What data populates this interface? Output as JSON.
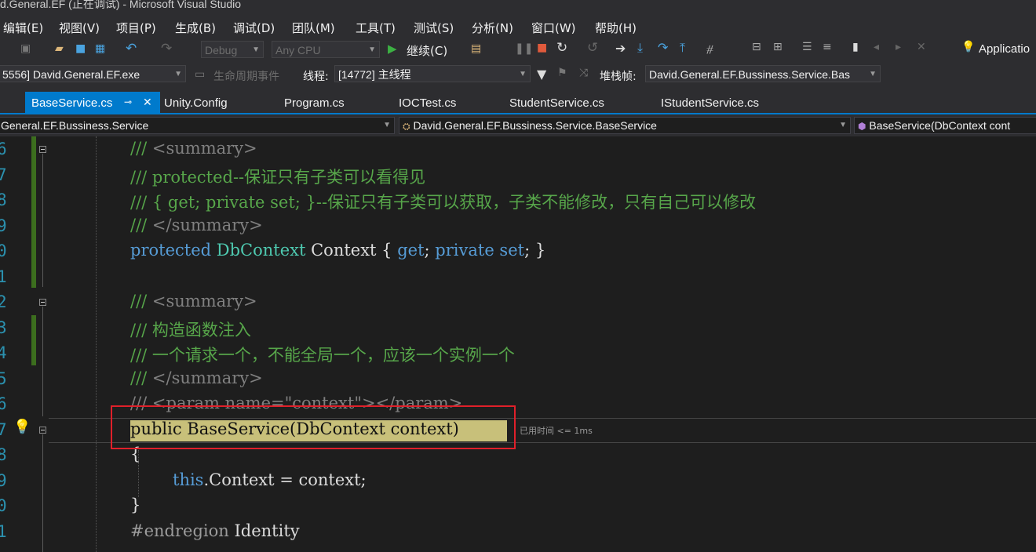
{
  "window": {
    "title": "d.General.EF (正在调试) - Microsoft Visual Studio"
  },
  "menu": [
    "编辑(E)",
    "视图(V)",
    "项目(P)",
    "生成(B)",
    "调试(D)",
    "团队(M)",
    "工具(T)",
    "测试(S)",
    "分析(N)",
    "窗口(W)",
    "帮助(H)"
  ],
  "toolbar": {
    "config": "Debug",
    "platform": "Any CPU",
    "continue_label": "继续(C)",
    "app_insights": "Applicatio"
  },
  "debugbar": {
    "process": "5556] David.General.EF.exe",
    "lifecycle": "生命周期事件",
    "thread_label": "线程:",
    "thread": "[14772] 主线程",
    "stackframe_label": "堆栈帧:",
    "stackframe": "David.General.EF.Bussiness.Service.Bas"
  },
  "tabs": [
    "BaseService.cs",
    "Unity.Config",
    "Program.cs",
    "IOCTest.cs",
    "StudentService.cs",
    "IStudentService.cs"
  ],
  "tab_pin": "ꟷ×",
  "nav": {
    "project": "General.EF.Bussiness.Service",
    "class": "David.General.EF.Bussiness.Service.BaseService",
    "member": "BaseService(DbContext cont"
  },
  "line_numbers": [
    "6",
    "7",
    "8",
    "9",
    "0",
    "1",
    "2",
    "3",
    "4",
    "5",
    "6",
    "7",
    "8",
    "9",
    "0",
    "1"
  ],
  "code": {
    "l6a": "/// ",
    "l6b": "<summary>",
    "l7": "/// protected--保证只有子类可以看得见",
    "l8": "/// { get; private set; }--保证只有子类可以获取，子类不能修改，只有自己可以修改",
    "l9a": "/// ",
    "l9b": "</summary>",
    "l10_kw1": "protected",
    "l10_ty": "DbContext",
    "l10_mid": "Context { ",
    "l10_kw2": "get",
    "l10_sep": "; ",
    "l10_kw3": "private set",
    "l10_end": "; }",
    "l12a": "/// ",
    "l12b": "<summary>",
    "l13": "/// 构造函数注入",
    "l14": "/// 一个请求一个，不能全局一个，应该一个实例一个",
    "l15a": "/// ",
    "l15b": "</summary>",
    "l16": "/// <param name=\"context\"></param>",
    "l17": "public BaseService(DbContext context)",
    "l18": "{",
    "l19_kw": "this",
    "l19_rest": ".Context = context;",
    "l20": "}",
    "l21a": "#endregion",
    "l21b": " Identity"
  },
  "codelens": "已用时间 <= 1ms"
}
